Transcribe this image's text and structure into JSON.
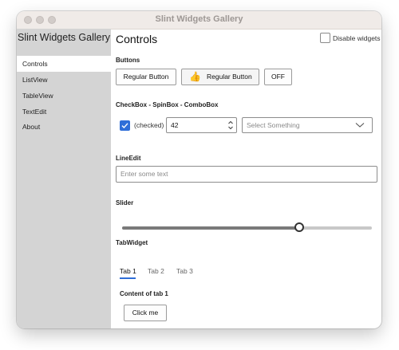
{
  "window": {
    "title": "Slint Widgets Gallery"
  },
  "sidebar": {
    "app_title": "Slint Widgets Gallery",
    "items": [
      {
        "label": "Controls",
        "active": true
      },
      {
        "label": "ListView",
        "active": false
      },
      {
        "label": "TableView",
        "active": false
      },
      {
        "label": "TextEdit",
        "active": false
      },
      {
        "label": "About",
        "active": false
      }
    ]
  },
  "header": {
    "title": "Controls",
    "disable_widgets_label": "Disable widgets",
    "disable_widgets_checked": false
  },
  "buttons_section": {
    "label": "Buttons",
    "regular_button": "Regular Button",
    "icon_button": "Regular Button",
    "icon_button_icon": "thumbs-up-icon",
    "toggle_button": "OFF"
  },
  "inputs_section": {
    "label": "CheckBox - SpinBox - ComboBox",
    "checkbox_label": "(checked)",
    "checkbox_checked": true,
    "spinbox_value": "42",
    "combobox_placeholder": "Select Something"
  },
  "lineedit_section": {
    "label": "LineEdit",
    "placeholder": "Enter some text"
  },
  "slider_section": {
    "label": "Slider",
    "value_fraction": 0.71
  },
  "tabwidget_section": {
    "label": "TabWidget",
    "tabs": [
      "Tab 1",
      "Tab 2",
      "Tab 3"
    ],
    "active_tab": 0,
    "content_label": "Content of tab 1",
    "click_button": "Click me"
  },
  "colors": {
    "accent": "#2f6ed8",
    "sidebar_bg": "#d4d4d4",
    "titlebar_bg": "#f0ebe8"
  }
}
